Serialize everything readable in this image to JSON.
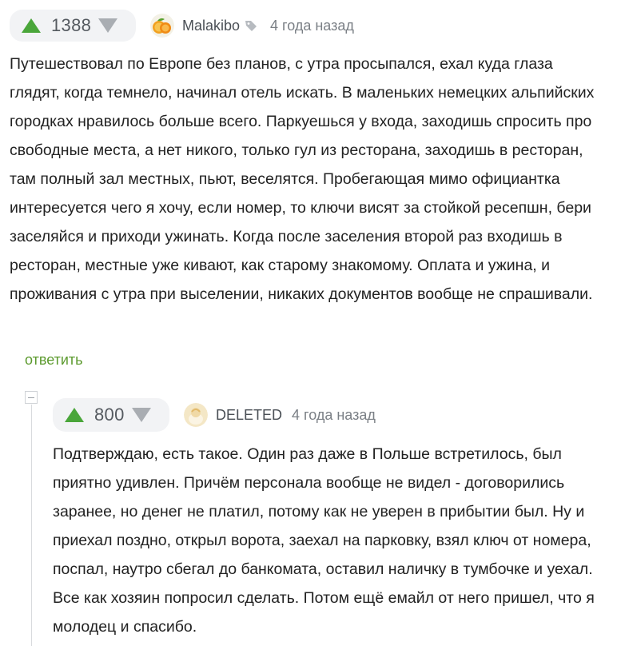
{
  "comment": {
    "rating": "1388",
    "author": "Malakibo",
    "time": "4 года назад",
    "text": "Путешествовал по Европе без планов, с утра просыпался, ехал куда глаза глядят, когда темнело, начинал отель искать. В маленьких немецких альпийских городках нравилось больше всего. Паркуешься у входа, заходишь спросить про свободные места, а нет никого, только гул из ресторана, заходишь в ресторан, там полный зал местных, пьют, веселятся. Пробегающая мимо официантка интересуется чего я хочу, если номер, то ключи висят за стойкой ресепшн, бери заселяйся и приходи ужинать. Когда после заселения второй раз входишь в ресторан, местные уже кивают, как старому знакомому. Оплата и ужина, и проживания с утра при выселении, никаких документов вообще не спрашивали.",
    "reply_label": "ответить"
  },
  "reply": {
    "rating": "800",
    "author": "DELETED",
    "time": "4 года назад",
    "text": "Подтверждаю, есть такое. Один раз даже в Польше встретилось, был приятно удивлен. Причём персонала вообще не видел - договорились заранее, но денег не платил, потому как не уверен в прибытии был. Ну и приехал поздно, открыл ворота, заехал на парковку, взял ключ от номера, поспал, наутро сбегал до банкомата, оставил наличку в тумбочке и уехал. Все как хозяин попросил сделать. Потом ещё емайл от него пришел, что я молодец и спасибо."
  },
  "icons": {
    "upvote": "triangle-up-icon",
    "downvote": "triangle-down-icon",
    "author_tag": "tag-icon",
    "collapse": "minus-icon"
  },
  "colors": {
    "upvote": "#4aa63a",
    "downvote": "#a9adb2",
    "reply_link": "#5c9a2e",
    "vote_box_bg": "#f2f3f5"
  }
}
